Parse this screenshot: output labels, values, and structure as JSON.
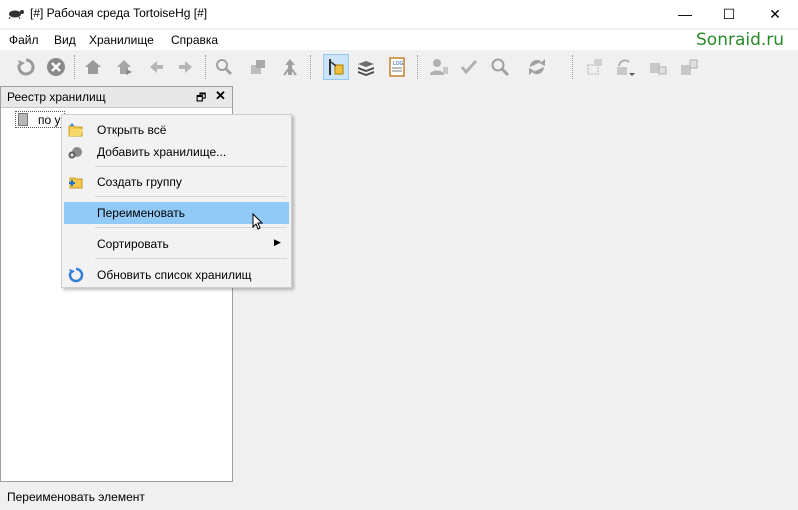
{
  "window": {
    "title": "[#] Рабочая среда TortoiseHg [#]",
    "icon": "tortoise-icon",
    "minimize": "—",
    "maximize": "☐",
    "close": "✕"
  },
  "menu": [
    "Файл",
    "Вид",
    "Хранилище",
    "Справка"
  ],
  "watermark": "Sonraid.ru",
  "toolbar": {
    "icons": [
      "refresh-icon",
      "stop-icon",
      "home-icon",
      "goto-icon",
      "back-icon",
      "forward-icon",
      "search-icon",
      "pull-icon",
      "merge-icon",
      "branch-icon",
      "stack-icon",
      "log-icon",
      "user-icon",
      "check-icon",
      "zoom-icon",
      "sync-icon",
      "repo-icon",
      "repo-dropdown-icon",
      "repo-down-icon",
      "repo-up-icon"
    ]
  },
  "registry": {
    "title": "Реестр хранилищ",
    "float": "🗗",
    "close": "✕",
    "item_label": "по у"
  },
  "context_menu": {
    "items": [
      {
        "label": "Открыть всё",
        "icon": "folder-open-icon"
      },
      {
        "label": "Добавить хранилище...",
        "icon": "add-repo-icon"
      },
      {
        "label": "Создать группу",
        "icon": "new-group-icon"
      },
      {
        "label": "Переименовать",
        "icon": ""
      },
      {
        "label": "Сортировать",
        "icon": "",
        "arrow": "▶"
      },
      {
        "label": "Обновить список хранилищ",
        "icon": "refresh-icon"
      }
    ]
  },
  "status": "Переименовать элемент",
  "colors": {
    "highlight": "#91c9f7",
    "toolbar_active": "#cce4f7",
    "watermark": "#2a8a2a"
  }
}
